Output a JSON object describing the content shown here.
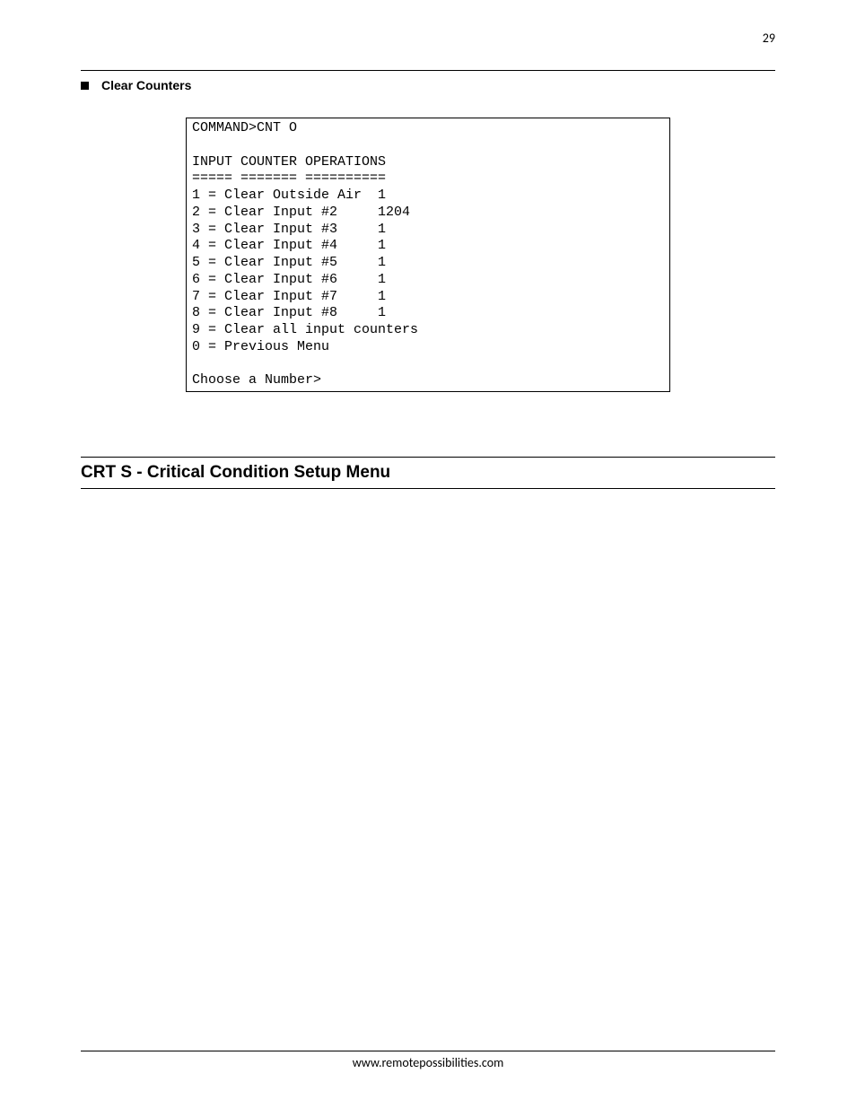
{
  "page_number": "29",
  "bullet_label": "Clear Counters",
  "terminal": {
    "command_line": "COMMAND>CNT O",
    "header": "INPUT COUNTER OPERATIONS",
    "underline": "===== ======= ==========",
    "rows": [
      {
        "text": "1 = Clear Outside Air  1"
      },
      {
        "text": "2 = Clear Input #2     1204"
      },
      {
        "text": "3 = Clear Input #3     1"
      },
      {
        "text": "4 = Clear Input #4     1"
      },
      {
        "text": "5 = Clear Input #5     1"
      },
      {
        "text": "6 = Clear Input #6     1"
      },
      {
        "text": "7 = Clear Input #7     1"
      },
      {
        "text": "8 = Clear Input #8     1"
      },
      {
        "text": "9 = Clear all input counters"
      },
      {
        "text": "0 = Previous Menu"
      }
    ],
    "prompt": "Choose a Number>"
  },
  "section_title": "CRT S - Critical Condition Setup Menu",
  "footer": "www.remotepossibilities.com"
}
